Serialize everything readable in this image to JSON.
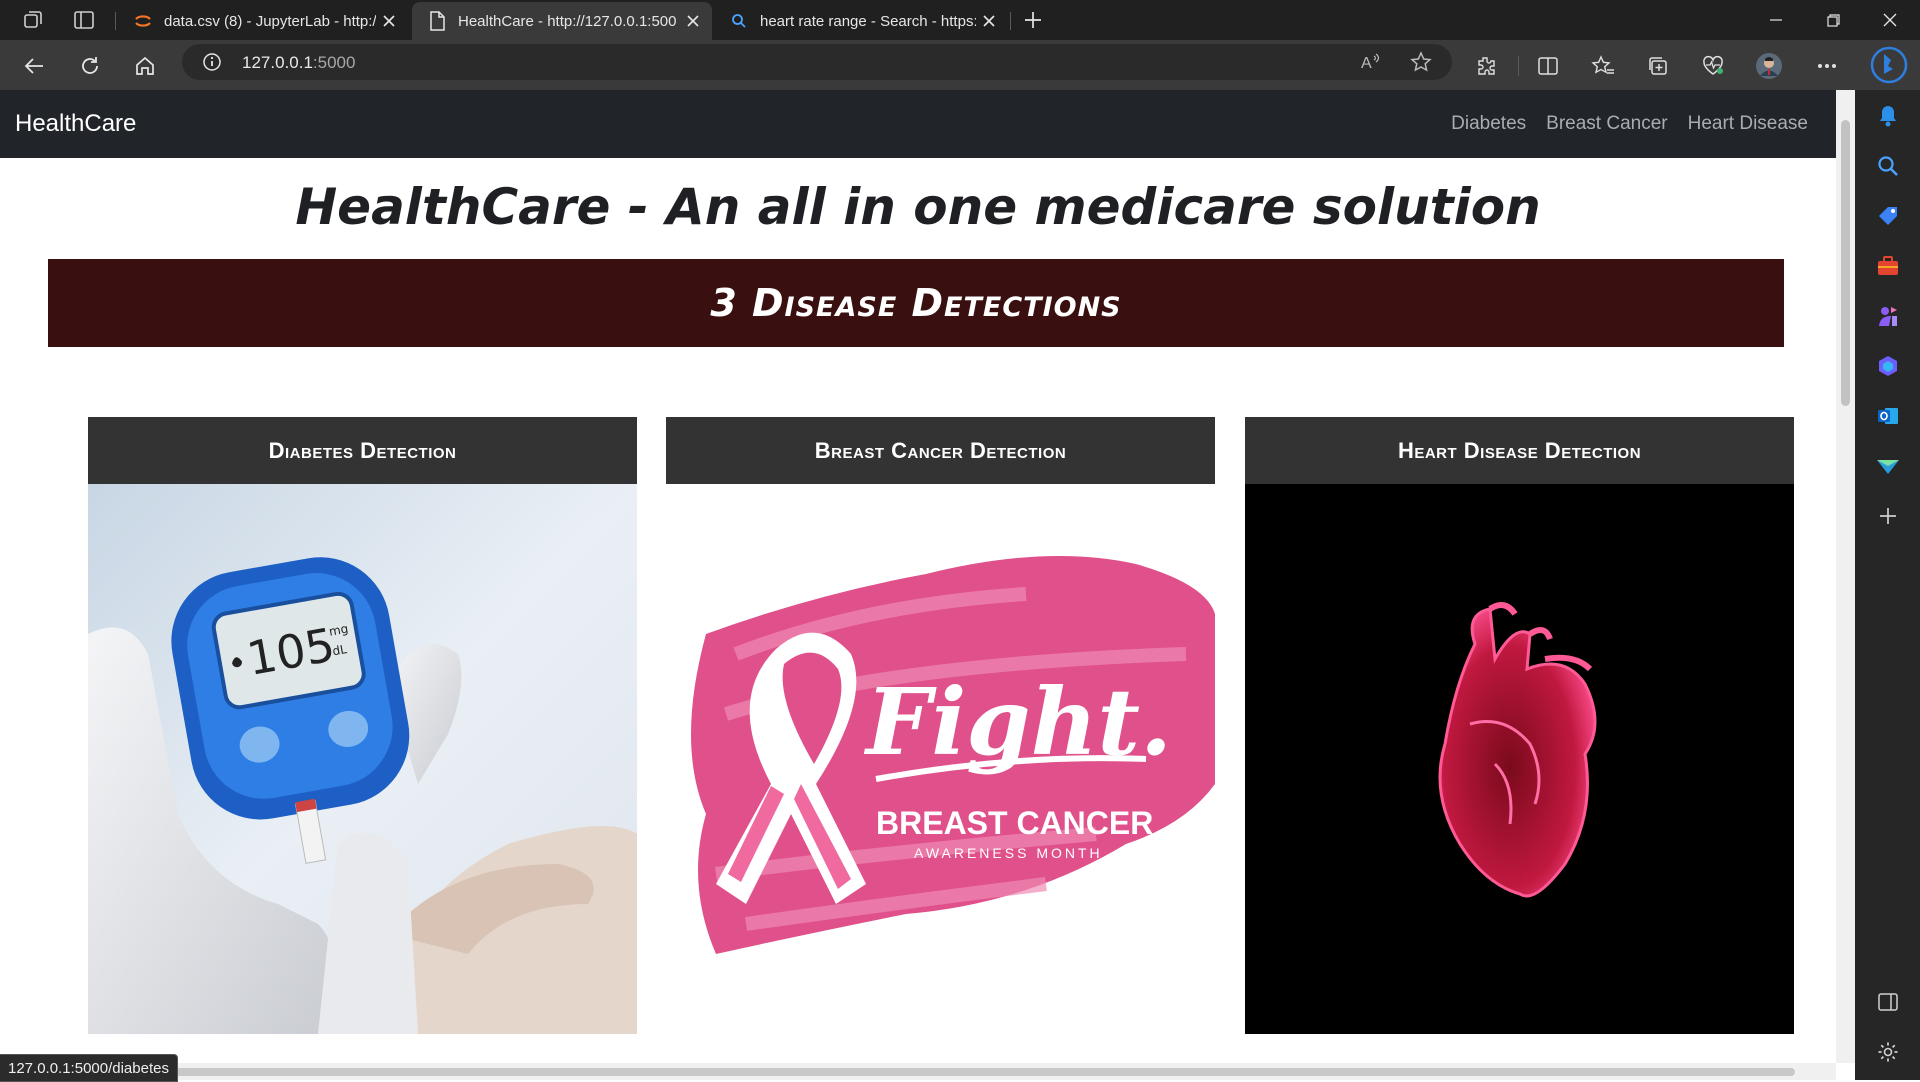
{
  "browser": {
    "tabs": [
      {
        "title": "data.csv (8) - JupyterLab - http://",
        "active": false,
        "icon": "jupyter-icon"
      },
      {
        "title": "HealthCare - http://127.0.0.1:500",
        "active": true,
        "icon": "page-icon"
      },
      {
        "title": "heart rate range - Search - https:",
        "active": false,
        "icon": "search-icon"
      }
    ],
    "address": {
      "host": "127.0.0.1",
      "port": ":5000"
    },
    "status_url": "127.0.0.1:5000/diabetes"
  },
  "navbar": {
    "brand": "HealthCare",
    "links": [
      "Diabetes",
      "Breast Cancer",
      "Heart Disease"
    ]
  },
  "page": {
    "title": "HealthCare - An all in one medicare solution",
    "banner": "3 Disease Detections"
  },
  "cards": [
    {
      "heading": "Diabetes Detection",
      "image": "glucometer-reading",
      "meter_value": "105",
      "meter_unit_top": "mg",
      "meter_unit_bottom": "dL"
    },
    {
      "heading": "Breast Cancer Detection",
      "image": "pink-ribbon-fight",
      "overlay_big": "Fight.",
      "overlay_mid": "BREAST CANCER",
      "overlay_small": "AWARENESS MONTH"
    },
    {
      "heading": "Heart Disease Detection",
      "image": "anatomical-heart"
    }
  ],
  "colors": {
    "navbar": "#212529",
    "banner": "#3a0f10",
    "card_header": "#333333",
    "ribbon": "#e0508a"
  }
}
